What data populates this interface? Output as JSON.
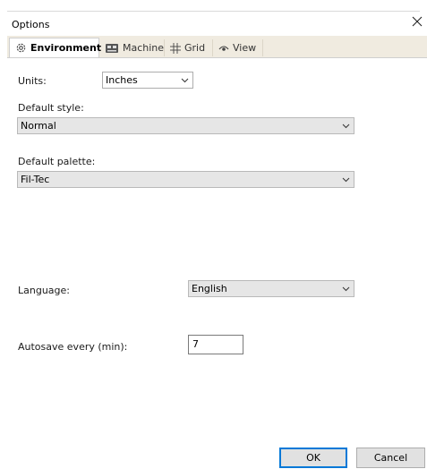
{
  "window": {
    "title": "Options"
  },
  "tabs": [
    {
      "label": "Environment",
      "icon": "gear-icon"
    },
    {
      "label": "Machine",
      "icon": "machine-icon"
    },
    {
      "label": "Grid",
      "icon": "grid-icon"
    },
    {
      "label": "View",
      "icon": "eye-icon"
    }
  ],
  "environment": {
    "units_label": "Units:",
    "units_value": "Inches",
    "default_style_label": "Default style:",
    "default_style_value": "Normal",
    "default_palette_label": "Default palette:",
    "default_palette_value": "Fil-Tec",
    "language_label": "Language:",
    "language_value": "English",
    "autosave_label": "Autosave every (min):",
    "autosave_value": "7"
  },
  "buttons": {
    "ok": "OK",
    "cancel": "Cancel"
  }
}
